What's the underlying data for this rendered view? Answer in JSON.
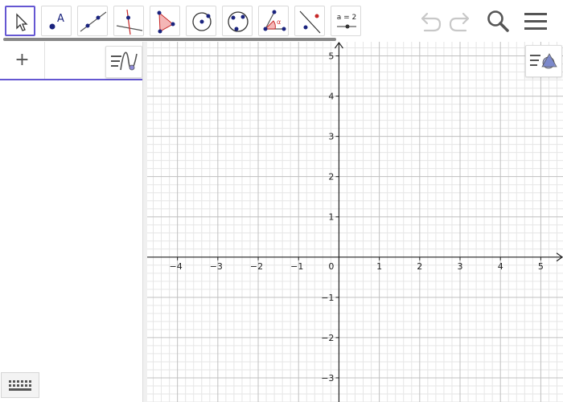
{
  "toolbar": {
    "tools": [
      {
        "name": "move-tool",
        "selected": true
      },
      {
        "name": "point-tool",
        "label": "A",
        "selected": false
      },
      {
        "name": "line-tool",
        "selected": false
      },
      {
        "name": "perpendicular-line-tool",
        "selected": false
      },
      {
        "name": "polygon-tool",
        "selected": false
      },
      {
        "name": "circle-center-point-tool",
        "selected": false
      },
      {
        "name": "circle-three-points-tool",
        "selected": false
      },
      {
        "name": "angle-tool",
        "label": "α",
        "selected": false
      },
      {
        "name": "reflect-tool",
        "selected": false
      },
      {
        "name": "slider-tool",
        "label": "a = 2",
        "selected": false
      }
    ],
    "undo_icon": "undo-icon",
    "redo_icon": "redo-icon",
    "search_icon": "search-icon",
    "menu_icon": "menu-icon"
  },
  "algebra": {
    "add_label": "+",
    "style_icon": "algebra-style-icon",
    "keyboard_icon": "keyboard-icon"
  },
  "graphics": {
    "style_icon": "graphics-style-icon",
    "x_axis": {
      "min": -4.75,
      "max": 5.55,
      "ticks": [
        -4,
        -3,
        -2,
        -1,
        1,
        2,
        3,
        4,
        5
      ],
      "tick_labels": [
        "−4",
        "−3",
        "−2",
        "−1",
        "1",
        "2",
        "3",
        "4",
        "5"
      ]
    },
    "y_axis": {
      "min": -3.6,
      "max": 5.35,
      "ticks": [
        -3,
        -2,
        -1,
        1,
        2,
        3,
        4,
        5
      ],
      "tick_labels": [
        "−3",
        "−2",
        "−1",
        "1",
        "2",
        "3",
        "4",
        "5"
      ]
    },
    "origin_label": "0",
    "grid": true,
    "minor_divisions": 5
  },
  "colors": {
    "accent": "#6557d2",
    "point": "#1a237e",
    "polygon_fill": "#f4b6b6",
    "angle_red": "#d32f2f"
  }
}
